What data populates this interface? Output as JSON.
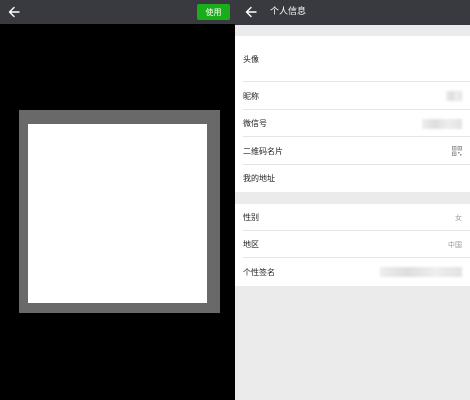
{
  "crop_screen": {
    "use_button_label": "使用",
    "back_icon": "arrow-left-icon",
    "colors": {
      "toolbar": "#393a3f",
      "use_button": "#1aad19",
      "frame": "#696969",
      "image": "#ffffff"
    }
  },
  "profile": {
    "title": "个人信息",
    "back_icon": "arrow-left-icon",
    "group1": [
      {
        "label": "头像"
      },
      {
        "label": "昵称"
      },
      {
        "label": "微信号"
      },
      {
        "label": "二维码名片",
        "icon": "qr-code-icon"
      },
      {
        "label": "我的地址"
      }
    ],
    "group2": [
      {
        "label": "性别",
        "value": "女"
      },
      {
        "label": "地区",
        "value": "中国"
      },
      {
        "label": "个性签名"
      }
    ],
    "colors": {
      "toolbar": "#393a3f",
      "background": "#ebebeb",
      "row": "#ffffff"
    }
  }
}
